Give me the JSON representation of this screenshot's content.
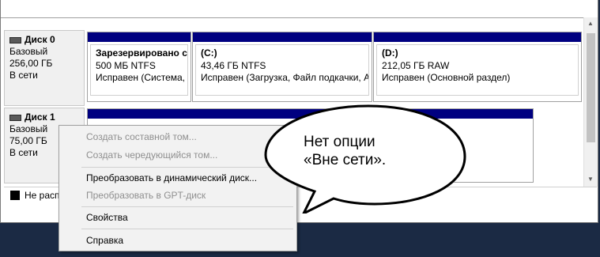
{
  "disks": [
    {
      "name": "Диск 0",
      "type": "Базовый",
      "size": "256,00 ГБ",
      "status": "В сети",
      "partitions": [
        {
          "title": "Зарезервировано си",
          "line1": "500 МБ NTFS",
          "line2": "Исправен (Система, А"
        },
        {
          "title": "(C:)",
          "line1": "43,46 ГБ NTFS",
          "line2": "Исправен (Загрузка, Файл подкачки, А"
        },
        {
          "title": "(D:)",
          "line1": "212,05 ГБ RAW",
          "line2": "Исправен (Основной раздел)"
        }
      ]
    },
    {
      "name": "Диск 1",
      "type": "Базовый",
      "size": "75,00 ГБ",
      "status": "В сети"
    }
  ],
  "legend": {
    "unallocated": "Не распр"
  },
  "context_menu": {
    "items": [
      {
        "label": "Создать составной том...",
        "enabled": false
      },
      {
        "label": "Создать чередующийся том...",
        "enabled": false
      },
      {
        "label": "Преобразовать в динамический диск...",
        "enabled": true
      },
      {
        "label": "Преобразовать в GPT-диск",
        "enabled": false
      },
      {
        "label": "Свойства",
        "enabled": true
      },
      {
        "label": "Справка",
        "enabled": true
      }
    ]
  },
  "callout": {
    "line1": "Нет опции",
    "line2": "«Вне сети»."
  },
  "colors": {
    "partition_bar": "#000080",
    "disabled_text": "#8f8f8f"
  }
}
